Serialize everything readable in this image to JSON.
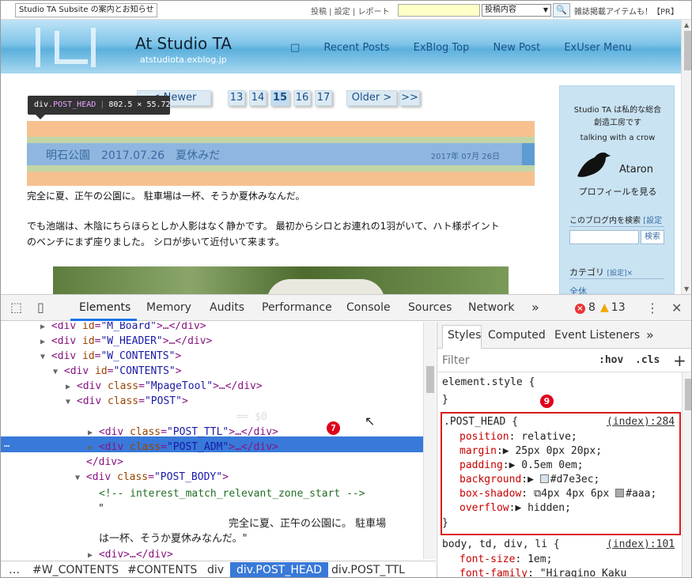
{
  "topbar": {
    "notice": "Studio TA Subsite の案内とお知らせ",
    "links": "投稿 | 設定 | レポート",
    "search_select": "投稿内容",
    "ads": "雑誌掲載アイテムも！【PR】"
  },
  "header": {
    "title": "At Studio TA",
    "subtitle": "atstudiota.exblog.jp",
    "nav": [
      "□",
      "Recent Posts",
      "ExBlog Top",
      "New Post",
      "ExUser Menu"
    ]
  },
  "pager": {
    "newer": "< Newer",
    "pages": [
      "13",
      "14",
      "15",
      "16",
      "17"
    ],
    "current": "15",
    "older": "Older >",
    "last": ">>"
  },
  "tooltip": {
    "tag": "div",
    "cls": ".POST_HEAD",
    "size": "802.5 × 55.72"
  },
  "post": {
    "title": "明石公園　2017.07.26　夏休みだ",
    "date": "2017年 07月 26日",
    "line1": "完全に夏、正午の公園に。 駐車場は一杯、そうか夏休みなんだ。",
    "line2": "でも池端は、木陰にちらほらとしか人影はなく静かです。 最初からシロとお連れの1羽がいて、ハト様ポイント",
    "line3": "のベンチにまず座りました。 シロが歩いて近付いて来ます。"
  },
  "sidebar": {
    "intro1": "Studio TA は私的な総合",
    "intro2": "創造工房です",
    "tagline": "talking with a crow",
    "name": "Ataron",
    "profile": "プロフィールを見る",
    "search_label": "このブログ内を検索",
    "search_settings": "[設定",
    "search_button": "検索",
    "category_label": "カテゴリ",
    "category_settings": "[設定]×",
    "category_first": "全休"
  },
  "devtools": {
    "tabs": [
      "Elements",
      "Memory",
      "Audits",
      "Performance",
      "Console",
      "Sources",
      "Network"
    ],
    "more": "»",
    "errors": "8",
    "warnings": "13",
    "menu": "⋮",
    "close": "✕"
  },
  "dom": {
    "r1": {
      "tag": "div",
      "attr": "id",
      "val": "\"M_Board\"",
      "rest": ">…</div>"
    },
    "r2": {
      "tag": "div",
      "attr": "id",
      "val": "\"W_HEADER\"",
      "rest": ">…</div>"
    },
    "r3": {
      "tag": "div",
      "attr": "id",
      "val": "\"W_CONTENTS\"",
      "rest": ">"
    },
    "r4": {
      "tag": "div",
      "attr": "id",
      "val": "\"CONTENTS\"",
      "rest": ">"
    },
    "r5": {
      "tag": "div",
      "attr": "class",
      "val": "\"MpageTool\"",
      "rest": ">…</div>"
    },
    "r6": {
      "tag": "div",
      "attr": "class",
      "val": "\"POST\"",
      "rest": ">"
    },
    "r7": {
      "tag": "div",
      "attr": "class",
      "val": "\"POST_HEAD\"",
      "rest": ">",
      "eq": "== $0"
    },
    "r8": {
      "tag": "div",
      "attr": "class",
      "val": "\"POST_TTL\"",
      "rest": ">…</div>"
    },
    "r9": {
      "tag": "div",
      "attr": "class",
      "val": "\"POST_ADM\"",
      "rest": ">…</div>"
    },
    "r10": "</div>",
    "r11": {
      "tag": "div",
      "attr": "class",
      "val": "\"POST_BODY\"",
      "rest": ">"
    },
    "r12": "<!-- interest_match_relevant_zone_start -->",
    "r13": "\"",
    "r14": "完全に夏、正午の公園に。 駐車場",
    "r15": "は一杯、そうか夏休みなんだ。\"",
    "r16": "<div>…</div>",
    "dots": "…"
  },
  "badges": {
    "b7": "7",
    "b9": "9"
  },
  "breadcrumbs": [
    "…",
    "#W_CONTENTS",
    "#CONTENTS",
    "div",
    "div.POST_HEAD",
    "div.POST_TTL"
  ],
  "styles": {
    "tabs": [
      "Styles",
      "Computed",
      "Event Listeners",
      "»"
    ],
    "filter": "Filter",
    "hov": ":hov",
    "cls": ".cls",
    "plus": "+",
    "element_style": "element.style {",
    "close_brace": "}",
    "rule_selector": ".POST_HEAD {",
    "rule_source": "(index):284",
    "props": [
      {
        "name": "position",
        "value": "relative;"
      },
      {
        "name": "margin",
        "value": "25px 0px 20px;"
      },
      {
        "name": "padding",
        "value": "0.5em 0em;"
      },
      {
        "name": "background",
        "value": "#d7e3ec;"
      },
      {
        "name": "box-shadow",
        "value": "4px 4px 6px",
        "value2": "#aaa;"
      },
      {
        "name": "overflow",
        "value": "hidden;"
      }
    ],
    "rule2_selector": "body, td, div, li {",
    "rule2_source": "(index):101",
    "rule2_props": [
      {
        "name": "font-size",
        "value": "1em;"
      },
      {
        "name": "font-family",
        "value": "\"Hiragino Kaku"
      }
    ]
  },
  "colors": {
    "accent": "#3879d9",
    "highlight_box": "#d81c1c",
    "bg_swatch": "#d7e3ec",
    "shadow_swatch": "#aaaaaa"
  }
}
